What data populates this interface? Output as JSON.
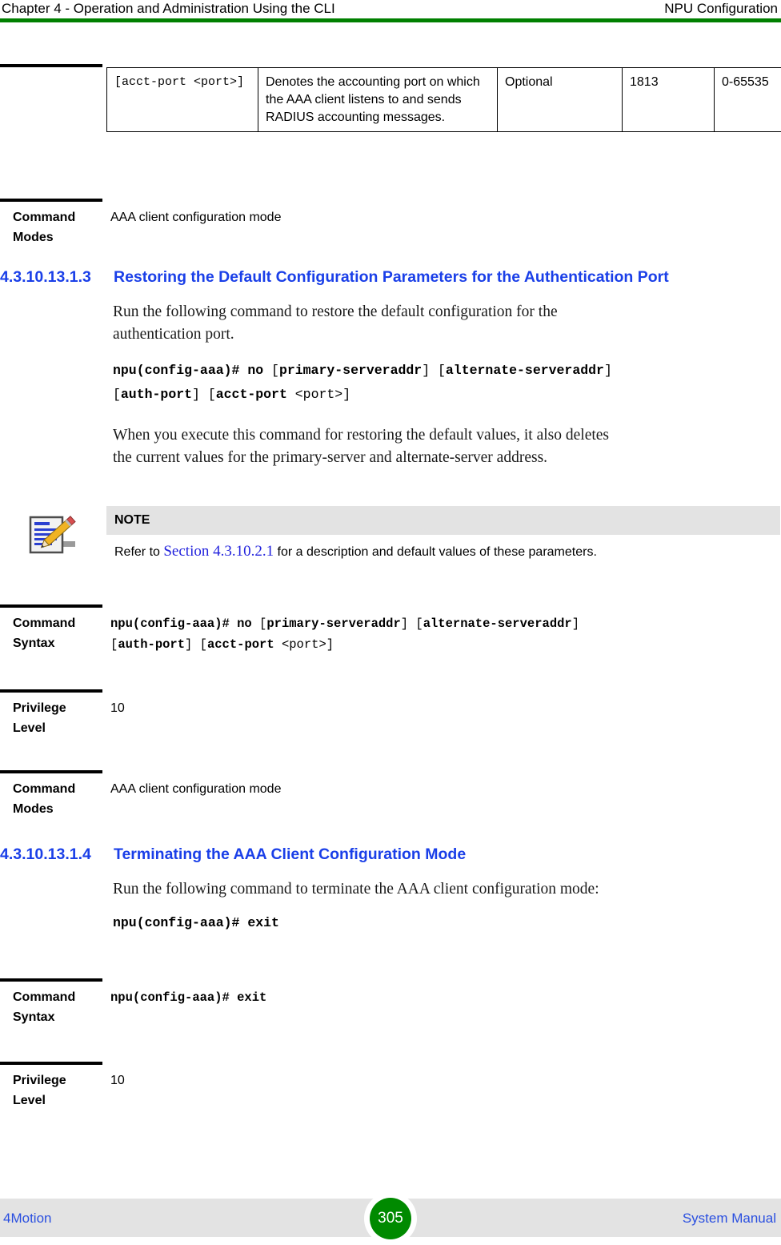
{
  "header": {
    "left": "Chapter 4 - Operation and Administration Using the CLI",
    "right": "NPU Configuration",
    "rule_color": "#008000"
  },
  "param_table": {
    "rows": [
      {
        "parameter": "[acct-port <port>]",
        "description": "Denotes the accounting port on which the AAA client listens to and sends RADIUS accounting messages.",
        "presence": "Optional",
        "default": "1813",
        "range": "0-65535"
      }
    ]
  },
  "attr_blocks": [
    {
      "id": "command-modes-1",
      "label": "Command Modes",
      "value": "AAA client configuration mode"
    },
    {
      "id": "command-syntax-1",
      "label": "Command Syntax",
      "value_line1_a": "npu(config-aaa)# no ",
      "value_line1_b": "[",
      "value_line1_c": "primary-serveraddr",
      "value_line1_d": "] [",
      "value_line1_e": "alternate-serveraddr",
      "value_line1_f": "]",
      "value_line2_a": "[",
      "value_line2_b": "auth-port",
      "value_line2_c": "] [",
      "value_line2_d": "acct-port ",
      "value_line2_e": "<port>]"
    },
    {
      "id": "privilege-level-1",
      "label": "Privilege Level",
      "value": "10"
    },
    {
      "id": "command-modes-2",
      "label": "Command Modes",
      "value": "AAA client configuration mode"
    },
    {
      "id": "command-syntax-2",
      "label": "Command Syntax",
      "value": "npu(config-aaa)# exit"
    },
    {
      "id": "privilege-level-2",
      "label": "Privilege Level",
      "value": "10"
    }
  ],
  "sections": [
    {
      "number": "4.3.10.13.1.3",
      "title": "Restoring the Default Configuration Parameters for the Authentication Port",
      "intro_line1": "Run the following command to restore the default configuration for the",
      "intro_line2": "authentication port.",
      "command": {
        "prefix": "npu(config-aaa)# no ",
        "open1": "[",
        "kw1": "primary-serveraddr",
        "mid1": "] [",
        "kw2": "alternate-serveraddr",
        "close1": "]",
        "open2": "[",
        "kw3": "auth-port",
        "mid2": "] [",
        "kw4": "acct-port ",
        "arg": "<port>]"
      },
      "after_line1": "When you execute this command for restoring the default values, it also deletes",
      "after_line2": "the current values for the primary-server and alternate-server address."
    },
    {
      "number": "4.3.10.13.1.4",
      "title": "Terminating the AAA Client Configuration Mode",
      "intro_line1": "Run the following command to terminate the AAA client configuration mode:",
      "command_text": "npu(config-aaa)# exit"
    }
  ],
  "note": {
    "heading": "NOTE",
    "text_before": "Refer to ",
    "xref": "Section 4.3.10.2.1",
    "text_after": " for a description and default values of these parameters.",
    "icon": "note-pencil-notepad-icon"
  },
  "footer": {
    "left": "4Motion",
    "page": "305",
    "right": "System Manual",
    "page_badge_color": "#008a00",
    "band_color": "#e3e3e3",
    "link_color": "#2a4fe0"
  }
}
